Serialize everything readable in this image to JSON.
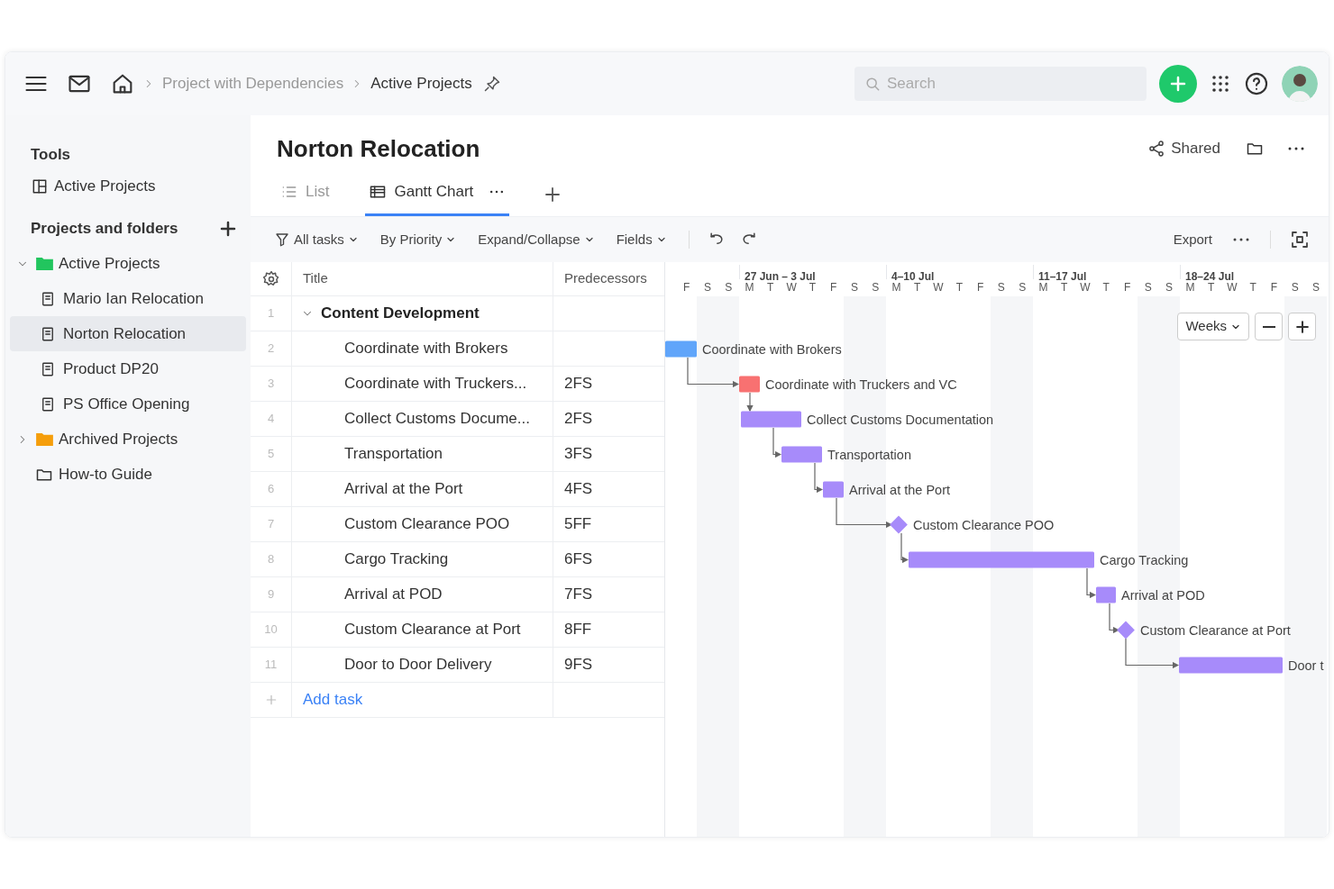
{
  "topbar": {
    "breadcrumbs": [
      {
        "label": "Project with Dependencies",
        "current": false
      },
      {
        "label": "Active Projects",
        "current": true
      }
    ],
    "search": {
      "placeholder": "Search"
    }
  },
  "sidebar": {
    "tools_title": "Tools",
    "tools": [
      {
        "label": "Active Projects"
      }
    ],
    "projects_title": "Projects and folders",
    "tree": [
      {
        "label": "Active Projects",
        "kind": "folder",
        "color": "#22c55e",
        "expanded": true,
        "selected": false,
        "children": [
          {
            "label": "Mario Ian Relocation",
            "selected": false
          },
          {
            "label": "Norton Relocation",
            "selected": true
          },
          {
            "label": "Product DP20",
            "selected": false
          },
          {
            "label": "PS Office Opening",
            "selected": false
          }
        ]
      },
      {
        "label": "Archived Projects",
        "kind": "folder",
        "color": "#f59e0b",
        "expanded": false,
        "selected": false
      },
      {
        "label": "How-to Guide",
        "kind": "outline",
        "selected": false
      }
    ]
  },
  "header": {
    "title": "Norton Relocation",
    "shared": "Shared"
  },
  "tabs": [
    {
      "label": "List",
      "kind": "list",
      "selected": false
    },
    {
      "label": "Gantt Chart",
      "kind": "gantt",
      "selected": true
    }
  ],
  "toolbar": {
    "filters": [
      "All tasks",
      "By Priority",
      "Expand/Collapse",
      "Fields"
    ],
    "export": "Export"
  },
  "table": {
    "columns": [
      "Title",
      "Predecessors"
    ],
    "rows": [
      {
        "num": "1",
        "title": "Content Development",
        "predecessors": "",
        "kind": "group",
        "expanded": true
      },
      {
        "num": "2",
        "title": "Coordinate with Brokers",
        "predecessors": "",
        "kind": "task"
      },
      {
        "num": "3",
        "title": "Coordinate with Truckers...",
        "predecessors": "2FS",
        "kind": "task"
      },
      {
        "num": "4",
        "title": "Collect Customs Docume...",
        "predecessors": "2FS",
        "kind": "task"
      },
      {
        "num": "5",
        "title": "Transportation",
        "predecessors": "3FS",
        "kind": "task"
      },
      {
        "num": "6",
        "title": "Arrival at the Port",
        "predecessors": "4FS",
        "kind": "task"
      },
      {
        "num": "7",
        "title": "Custom Clearance POO",
        "predecessors": "5FF",
        "kind": "task"
      },
      {
        "num": "8",
        "title": "Cargo Tracking",
        "predecessors": "6FS",
        "kind": "task"
      },
      {
        "num": "9",
        "title": "Arrival at POD",
        "predecessors": "7FS",
        "kind": "task"
      },
      {
        "num": "10",
        "title": "Custom Clearance at Port",
        "predecessors": "8FF",
        "kind": "task"
      },
      {
        "num": "11",
        "title": "Door to Door Delivery",
        "predecessors": "9FS",
        "kind": "task"
      }
    ],
    "add_task": "Add task"
  },
  "timeline": {
    "weeks": [
      "27 Jun – 3 Jul",
      "4–10 Jul",
      "11–17 Jul",
      "18–24 Jul"
    ],
    "days": [
      "F",
      "S",
      "S",
      "M",
      "T",
      "W",
      "T",
      "F",
      "S",
      "S",
      "M",
      "T",
      "W",
      "T",
      "F",
      "S",
      "S",
      "M",
      "T",
      "W",
      "T",
      "F",
      "S",
      "S",
      "M",
      "T",
      "W",
      "T",
      "F",
      "S",
      "S"
    ],
    "scale": "Weeks",
    "bars": [
      {
        "label": "Coordinate with Brokers",
        "kind": "bar",
        "color": "#60a5fa"
      },
      {
        "label": "Coordinate with Truckers and VC",
        "kind": "bar",
        "color": "#f87171"
      },
      {
        "label": "Collect Customs Documentation",
        "kind": "bar",
        "color": "#a78bfa"
      },
      {
        "label": "Transportation",
        "kind": "bar",
        "color": "#a78bfa"
      },
      {
        "label": "Arrival at the Port",
        "kind": "bar",
        "color": "#a78bfa"
      },
      {
        "label": "Custom Clearance POO",
        "kind": "milestone",
        "color": "#a78bfa"
      },
      {
        "label": "Cargo Tracking",
        "kind": "bar",
        "color": "#a78bfa"
      },
      {
        "label": "Arrival at POD",
        "kind": "bar",
        "color": "#a78bfa"
      },
      {
        "label": "Custom Clearance at Port",
        "kind": "milestone",
        "color": "#a78bfa"
      },
      {
        "label": "Door t",
        "kind": "bar",
        "color": "#a78bfa"
      }
    ]
  }
}
